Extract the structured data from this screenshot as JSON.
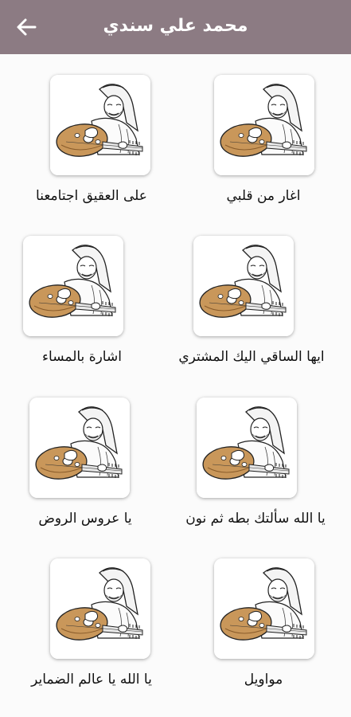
{
  "app": {
    "title": "محمد علي سندي",
    "back_icon": "arrow-left-icon",
    "bar_color": "#8c7b83"
  },
  "songs": [
    {
      "label": "اغار من قلبي"
    },
    {
      "label": "على العقيق اجتامعنا"
    },
    {
      "label": "ايها الساقي اليك المشتري"
    },
    {
      "label": "اشارة بالمساء"
    },
    {
      "label": "يا الله سألتك بطه ثم نون"
    },
    {
      "label": "يا عروس الروض"
    },
    {
      "label": "مواويل"
    },
    {
      "label": "يا الله يا عالم الضماير"
    }
  ],
  "thumbnail_icon": "oud-player-icon"
}
